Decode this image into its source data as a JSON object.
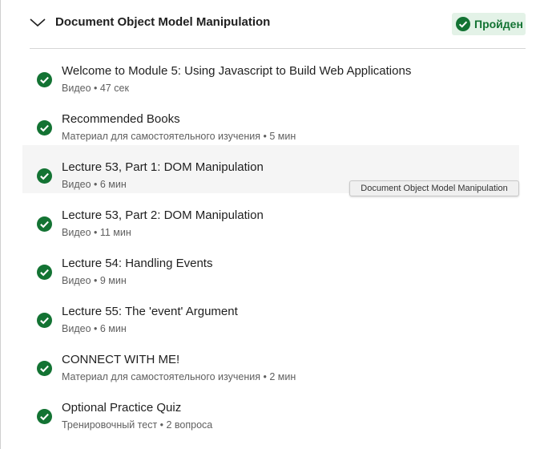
{
  "module": {
    "title": "Document Object Model Manipulation",
    "collapse_icon": "chevron-down-icon",
    "status": {
      "label": "Пройден",
      "icon": "check-circle-icon",
      "color": "#137333",
      "background": "#e3f2e7"
    }
  },
  "items": [
    {
      "title": "Welcome to Module 5: Using Javascript to Build Web Applications",
      "type": "Видео",
      "duration": "47 сек",
      "completed": true
    },
    {
      "title": "Recommended Books",
      "type": "Материал для самостоятельного изучения",
      "duration": "5 мин",
      "completed": true
    },
    {
      "title": "Lecture 53, Part 1: DOM Manipulation",
      "type": "Видео",
      "duration": "6 мин",
      "completed": true
    },
    {
      "title": "Lecture 53, Part 2: DOM Manipulation",
      "type": "Видео",
      "duration": "11 мин",
      "completed": true
    },
    {
      "title": "Lecture 54: Handling Events",
      "type": "Видео",
      "duration": "9 мин",
      "completed": true
    },
    {
      "title": "Lecture 55: The 'event' Argument",
      "type": "Видео",
      "duration": "6 мин",
      "completed": true
    },
    {
      "title": "CONNECT WITH ME!",
      "type": "Материал для самостоятельного изучения",
      "duration": "2 мин",
      "completed": true
    },
    {
      "title": "Optional Practice Quiz",
      "type": "Тренировочный тест",
      "duration": "2 вопроса",
      "completed": true
    }
  ],
  "tooltip": {
    "text": "Document Object Model Manipulation"
  },
  "colors": {
    "check_green": "#137333",
    "hover_row": "#f5f5f5"
  }
}
